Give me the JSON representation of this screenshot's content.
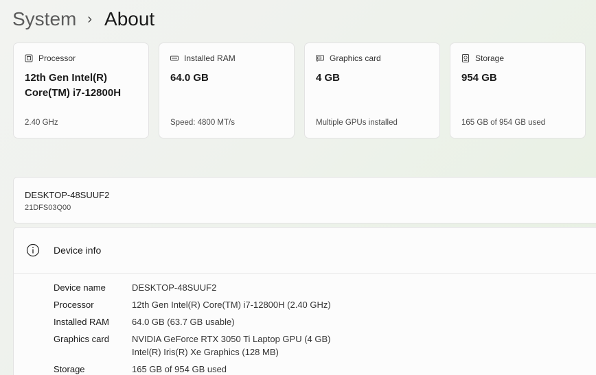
{
  "breadcrumb": {
    "parent": "System",
    "separator": "›",
    "current": "About"
  },
  "cards": [
    {
      "icon": "processor-icon",
      "label": "Processor",
      "value": "12th Gen Intel(R) Core(TM) i7-12800H",
      "sub": "2.40 GHz"
    },
    {
      "icon": "ram-icon",
      "label": "Installed RAM",
      "value": "64.0 GB",
      "sub": "Speed: 4800 MT/s"
    },
    {
      "icon": "graphics-card-icon",
      "label": "Graphics card",
      "value": "4 GB",
      "sub": "Multiple GPUs installed"
    },
    {
      "icon": "storage-icon",
      "label": "Storage",
      "value": "954 GB",
      "sub": "165 GB of 954 GB used"
    }
  ],
  "device": {
    "name": "DESKTOP-48SUUF2",
    "model": "21DFS03Q00"
  },
  "device_info": {
    "title": "Device info",
    "icon": "info-icon",
    "rows": [
      {
        "label": "Device name",
        "value": "DESKTOP-48SUUF2"
      },
      {
        "label": "Processor",
        "value": "12th Gen Intel(R) Core(TM) i7-12800H (2.40 GHz)"
      },
      {
        "label": "Installed RAM",
        "value": "64.0 GB (63.7 GB usable)"
      },
      {
        "label": "Graphics card",
        "value": "NVIDIA GeForce RTX 3050 Ti Laptop GPU (4 GB)",
        "value2": "Intel(R) Iris(R) Xe Graphics (128 MB)"
      },
      {
        "label": "Storage",
        "value": "165 GB of 954 GB used"
      }
    ]
  }
}
